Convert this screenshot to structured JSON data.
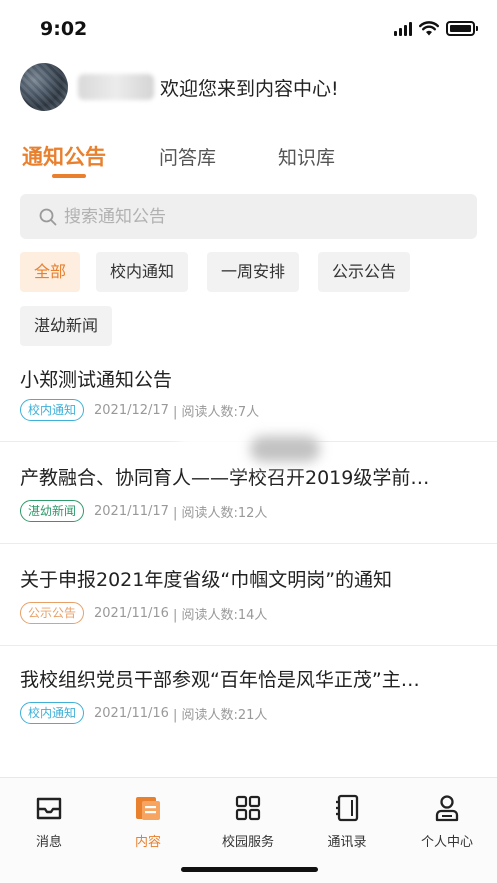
{
  "status_bar": {
    "time": "9:02"
  },
  "header": {
    "welcome": "欢迎您来到内容中心!"
  },
  "tabs": [
    {
      "label": "通知公告",
      "active": true
    },
    {
      "label": "问答库",
      "active": false
    },
    {
      "label": "知识库",
      "active": false
    }
  ],
  "search": {
    "placeholder": "搜索通知公告"
  },
  "filters": [
    {
      "label": "全部",
      "active": true
    },
    {
      "label": "校内通知",
      "active": false
    },
    {
      "label": "一周安排",
      "active": false
    },
    {
      "label": "公示公告",
      "active": false
    },
    {
      "label": "湛幼新闻",
      "active": false
    }
  ],
  "news": [
    {
      "title": "小郑测试通知公告",
      "tag": "校内通知",
      "tag_color": "#3fb0d8",
      "date": "2021/12/17",
      "reads": "| 阅读人数:7人"
    },
    {
      "title": "产教融合、协同育人——学校召开2019级学前…",
      "tag": "湛幼新闻",
      "tag_color": "#2f9a6a",
      "date": "2021/11/17",
      "reads": "| 阅读人数:12人"
    },
    {
      "title": "关于申报2021年度省级“巾帼文明岗”的通知",
      "tag": "公示公告",
      "tag_color": "#e8a068",
      "date": "2021/11/16",
      "reads": "| 阅读人数:14人"
    },
    {
      "title": "我校组织党员干部参观“百年恰是风华正茂”主…",
      "tag": "校内通知",
      "tag_color": "#3fb0d8",
      "date": "2021/11/16",
      "reads": "| 阅读人数:21人"
    }
  ],
  "tabbar": [
    {
      "label": "消息",
      "icon": "inbox-icon",
      "active": false
    },
    {
      "label": "内容",
      "icon": "content-icon",
      "active": true
    },
    {
      "label": "校园服务",
      "icon": "grid-icon",
      "active": false
    },
    {
      "label": "通讯录",
      "icon": "contacts-icon",
      "active": false
    },
    {
      "label": "个人中心",
      "icon": "user-icon",
      "active": false
    }
  ],
  "colors": {
    "accent": "#e8802e",
    "text": "#222222",
    "muted": "#999999"
  }
}
